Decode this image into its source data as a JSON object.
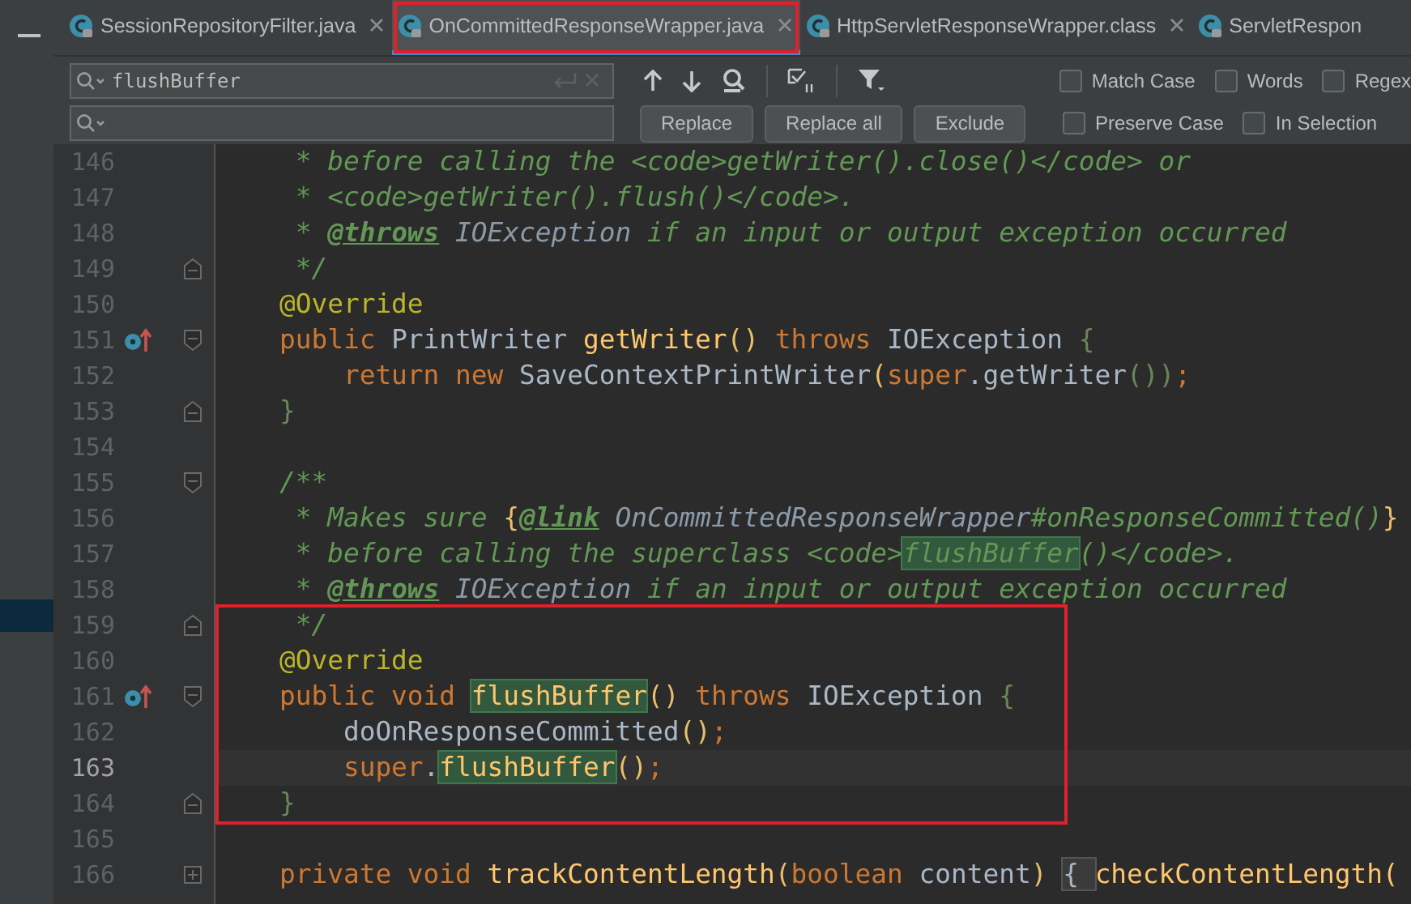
{
  "tabs": [
    {
      "label": "SessionRepositoryFilter.java",
      "selected": false,
      "framed": false,
      "closable": true
    },
    {
      "label": "OnCommittedResponseWrapper.java",
      "selected": true,
      "framed": true,
      "closable": true
    },
    {
      "label": "HttpServletResponseWrapper.class",
      "selected": false,
      "framed": false,
      "closable": true
    },
    {
      "label": "ServletRespon",
      "selected": false,
      "framed": false,
      "closable": false
    }
  ],
  "find": {
    "value": "flushBuffer",
    "options": [
      {
        "label": "Match Case",
        "checked": false
      },
      {
        "label": "Words",
        "checked": false
      },
      {
        "label": "Regex",
        "checked": false
      }
    ]
  },
  "replace": {
    "buttons": [
      "Replace",
      "Replace all",
      "Exclude"
    ],
    "options": [
      {
        "label": "Preserve Case",
        "checked": false
      },
      {
        "label": "In Selection",
        "checked": false
      }
    ]
  },
  "lines": [
    {
      "number": "146",
      "current": false,
      "override": false,
      "framed": false,
      "kind": "plain",
      "tokens": [
        {
          "text": "     * before calling the <code>getWriter().close()</code> or",
          "kind": "comment"
        }
      ]
    },
    {
      "number": "147",
      "current": false,
      "override": false,
      "framed": false,
      "kind": "plain",
      "tokens": [
        {
          "text": "     * <code>getWriter().flush()</code>.",
          "kind": "comment"
        }
      ]
    },
    {
      "number": "148",
      "current": false,
      "override": false,
      "framed": false,
      "kind": "plain",
      "tokens": [
        {
          "text": "     * ",
          "kind": "comment"
        },
        {
          "text": "@throws",
          "kind": "doctag"
        },
        {
          "text": " IOException",
          "kind": "docref"
        },
        {
          "text": " if an input or output exception occurred",
          "kind": "comment"
        }
      ]
    },
    {
      "number": "149",
      "current": false,
      "override": false,
      "framed": false,
      "kind": "fold_end",
      "tokens": [
        {
          "text": "     */",
          "kind": "comment"
        }
      ]
    },
    {
      "number": "150",
      "current": false,
      "override": false,
      "framed": false,
      "kind": "plain",
      "tokens": [
        {
          "text": "    @Override",
          "kind": "annotation"
        }
      ]
    },
    {
      "number": "151",
      "current": false,
      "override": true,
      "framed": false,
      "kind": "fold_start",
      "tokens": [
        {
          "text": "    public ",
          "kind": "keyword"
        },
        {
          "text": "PrintWriter ",
          "kind": "plain"
        },
        {
          "text": "getWriter",
          "kind": "method"
        },
        {
          "text": "() ",
          "kind": "paren"
        },
        {
          "text": "throws ",
          "kind": "keyword"
        },
        {
          "text": "IOException ",
          "kind": "plain"
        },
        {
          "text": "{",
          "kind": "brace"
        }
      ]
    },
    {
      "number": "152",
      "current": false,
      "override": false,
      "framed": false,
      "kind": "plain",
      "tokens": [
        {
          "text": "        return new ",
          "kind": "keyword"
        },
        {
          "text": "SaveContextPrintWriter",
          "kind": "plain"
        },
        {
          "text": "(",
          "kind": "paren"
        },
        {
          "text": "super",
          "kind": "keyword"
        },
        {
          "text": ".getWriter",
          "kind": "plain"
        },
        {
          "text": "())",
          "kind": "brace"
        },
        {
          "text": ";",
          "kind": "keyword"
        }
      ]
    },
    {
      "number": "153",
      "current": false,
      "override": false,
      "framed": false,
      "kind": "fold_end",
      "tokens": [
        {
          "text": "    }",
          "kind": "brace"
        }
      ]
    },
    {
      "number": "154",
      "current": false,
      "override": false,
      "framed": false,
      "kind": "plain"
    },
    {
      "number": "155",
      "current": false,
      "override": false,
      "framed": false,
      "kind": "fold_start",
      "tokens": [
        {
          "text": "    /**",
          "kind": "comment"
        }
      ]
    },
    {
      "number": "156",
      "current": false,
      "override": false,
      "framed": false,
      "kind": "plain",
      "tokens": [
        {
          "text": "     * Makes sure ",
          "kind": "comment"
        },
        {
          "text": "{",
          "kind": "paren"
        },
        {
          "text": "@link",
          "kind": "doctag"
        },
        {
          "text": " OnCommittedResponseWrapper",
          "kind": "docref"
        },
        {
          "text": "#onResponseCommitted()",
          "kind": "comment"
        },
        {
          "text": "}",
          "kind": "paren"
        }
      ]
    },
    {
      "number": "157",
      "current": false,
      "override": false,
      "framed": false,
      "kind": "plain",
      "tokens": [
        {
          "text": "     * before calling the superclass <code>",
          "kind": "comment"
        },
        {
          "text": "flushBuffer",
          "kind": "comment_match"
        },
        {
          "text": "()</code>.",
          "kind": "comment"
        }
      ]
    },
    {
      "number": "158",
      "current": false,
      "override": false,
      "framed": false,
      "kind": "plain",
      "tokens": [
        {
          "text": "     * ",
          "kind": "comment"
        },
        {
          "text": "@throws",
          "kind": "doctag"
        },
        {
          "text": " IOException",
          "kind": "docref"
        },
        {
          "text": " if an input or output exception occurred",
          "kind": "comment"
        }
      ]
    },
    {
      "number": "159",
      "current": false,
      "override": false,
      "framed": true,
      "kind": "fold_end",
      "tokens": [
        {
          "text": "     */",
          "kind": "comment"
        }
      ]
    },
    {
      "number": "160",
      "current": false,
      "override": false,
      "framed": true,
      "kind": "plain",
      "tokens": [
        {
          "text": "    @Override",
          "kind": "annotation"
        }
      ]
    },
    {
      "number": "161",
      "current": false,
      "override": true,
      "framed": true,
      "kind": "fold_start",
      "tokens": [
        {
          "text": "    public void ",
          "kind": "keyword"
        },
        {
          "text": "flushBuffer",
          "kind": "match"
        },
        {
          "text": "() ",
          "kind": "paren"
        },
        {
          "text": "throws ",
          "kind": "keyword"
        },
        {
          "text": "IOException ",
          "kind": "plain"
        },
        {
          "text": "{",
          "kind": "brace"
        }
      ]
    },
    {
      "number": "162",
      "current": false,
      "override": false,
      "framed": true,
      "kind": "plain",
      "tokens": [
        {
          "text": "        doOnResponseCommitted",
          "kind": "plain"
        },
        {
          "text": "()",
          "kind": "paren"
        },
        {
          "text": ";",
          "kind": "keyword"
        }
      ]
    },
    {
      "number": "163",
      "current": true,
      "override": false,
      "framed": true,
      "kind": "plain",
      "tokens": [
        {
          "text": "        super",
          "kind": "keyword"
        },
        {
          "text": ".",
          "kind": "plain"
        },
        {
          "text": "flushBuffer",
          "kind": "match"
        },
        {
          "text": "()",
          "kind": "paren"
        },
        {
          "text": ";",
          "kind": "keyword"
        }
      ]
    },
    {
      "number": "164",
      "current": false,
      "override": false,
      "framed": true,
      "kind": "fold_end",
      "tokens": [
        {
          "text": "    }",
          "kind": "brace"
        }
      ]
    },
    {
      "number": "165",
      "current": false,
      "override": false,
      "framed": false,
      "kind": "plain"
    },
    {
      "number": "166",
      "current": false,
      "override": false,
      "framed": false,
      "kind": "expand",
      "tokens": [
        {
          "text": "    private void ",
          "kind": "keyword"
        },
        {
          "text": "trackContentLength",
          "kind": "method"
        },
        {
          "text": "(",
          "kind": "paren"
        },
        {
          "text": "boolean ",
          "kind": "keyword"
        },
        {
          "text": "content",
          "kind": "plain"
        },
        {
          "text": ") ",
          "kind": "paren"
        },
        {
          "text": "{ ",
          "kind": "folded"
        },
        {
          "text": "checkContentLength(",
          "kind": "method"
        }
      ]
    }
  ]
}
